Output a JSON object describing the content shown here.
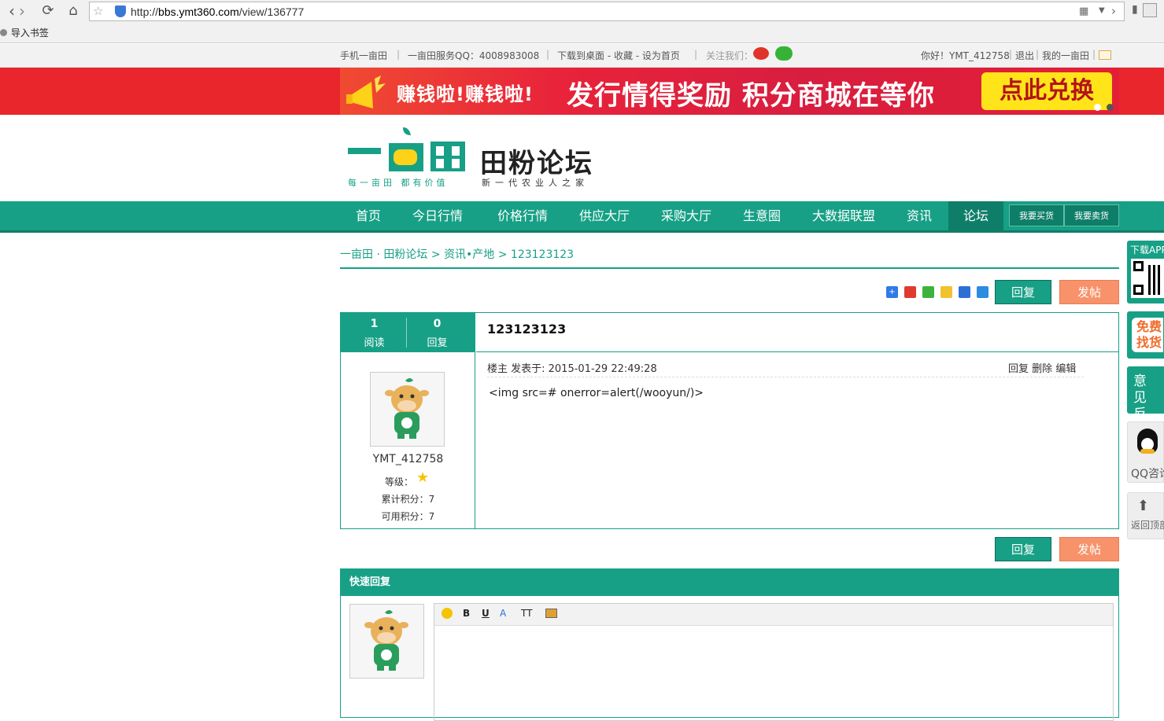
{
  "browser": {
    "url_prefix": "http://",
    "url_domain": "bbs.ymt360.com",
    "url_path": "/view/136777",
    "bookmark_label": "导入书签"
  },
  "topbar": {
    "mobile": "手机一亩田",
    "sep1": "|",
    "service_qq": "一亩田服务QQ：4008983008",
    "sep2": "|",
    "download": "下载到桌面 - 收藏 - 设为首页",
    "sep3": "|",
    "follow": "关注我们：",
    "greeting": "你好！YMT_412758",
    "logout": "退出",
    "my": "我的一亩田",
    "sep4": "|",
    "sep5": "|",
    "sep6": "|"
  },
  "banner": {
    "left_text": "赚钱啦!赚钱啦!",
    "main_text": "发行情得奖励 积分商城在等你",
    "button": "点此兑换"
  },
  "logo": {
    "slogan_left": "每一亩田 都有价值",
    "title": "田粉论坛",
    "slogan_right": "新一代农业人之家"
  },
  "nav": {
    "items": [
      "首页",
      "今日行情",
      "价格行情",
      "供应大厅",
      "采购大厅",
      "生意圈",
      "大数据联盟",
      "资讯",
      "论坛"
    ],
    "buy": "我要买货",
    "sell": "我要卖货"
  },
  "breadcrumb": {
    "root": "一亩田 · 田粉论坛",
    "sep1": ">",
    "section": "资讯•产地",
    "sep2": ">",
    "current": "123123123"
  },
  "actions": {
    "reply": "回复",
    "post": "发帖"
  },
  "post": {
    "views": "1",
    "views_label": "阅读",
    "replies": "0",
    "replies_label": "回复",
    "title": "123123123",
    "author": "YMT_412758",
    "level_label": "等级：",
    "total_points": "累计积分：7",
    "available_points": "可用积分：7",
    "meta": "楼主 发表于: 2015-01-29 22:49:28",
    "reply": "回复",
    "delete": "删除",
    "edit": "编辑",
    "body": "<img src=# onerror=alert(/wooyun/)>"
  },
  "quick_reply": {
    "title": "快速回复",
    "tools": [
      "B",
      "U",
      "A",
      "TT"
    ]
  },
  "float": {
    "download": "下载APP",
    "free": "免费找货",
    "feedback": "意见反馈",
    "qq": "QQ咨询",
    "top": "返回顶部"
  },
  "colors": {
    "brand_green": "#17a086",
    "brand_dark": "#0f7e69",
    "banner_red": "#e8262c",
    "banner_yellow": "#ffe41a",
    "post_orange": "#f7926a"
  }
}
